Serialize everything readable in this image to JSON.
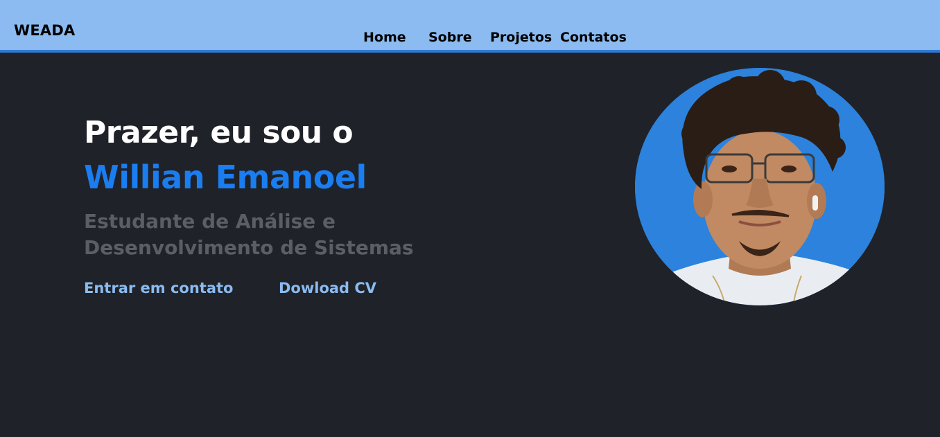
{
  "header": {
    "logo": "WEADA",
    "nav": [
      {
        "label": "Home"
      },
      {
        "label": "Sobre"
      },
      {
        "label": "Projetos"
      },
      {
        "label": "Contatos"
      }
    ]
  },
  "hero": {
    "greeting": "Prazer, eu sou o",
    "name": "Willian Emanoel",
    "subtitle": "Estudante de Análise e Desenvolvimento de Sistemas",
    "buttons": {
      "contact": "Entrar em contato",
      "cv": "Dowload CV"
    }
  },
  "colors": {
    "navbar": "#8bbbf0",
    "navbar_border": "#2f7bd3",
    "background": "#1f2228",
    "accent": "#1a7df0",
    "subtitle": "#5b5e63",
    "cta": "#8bbbf0"
  }
}
